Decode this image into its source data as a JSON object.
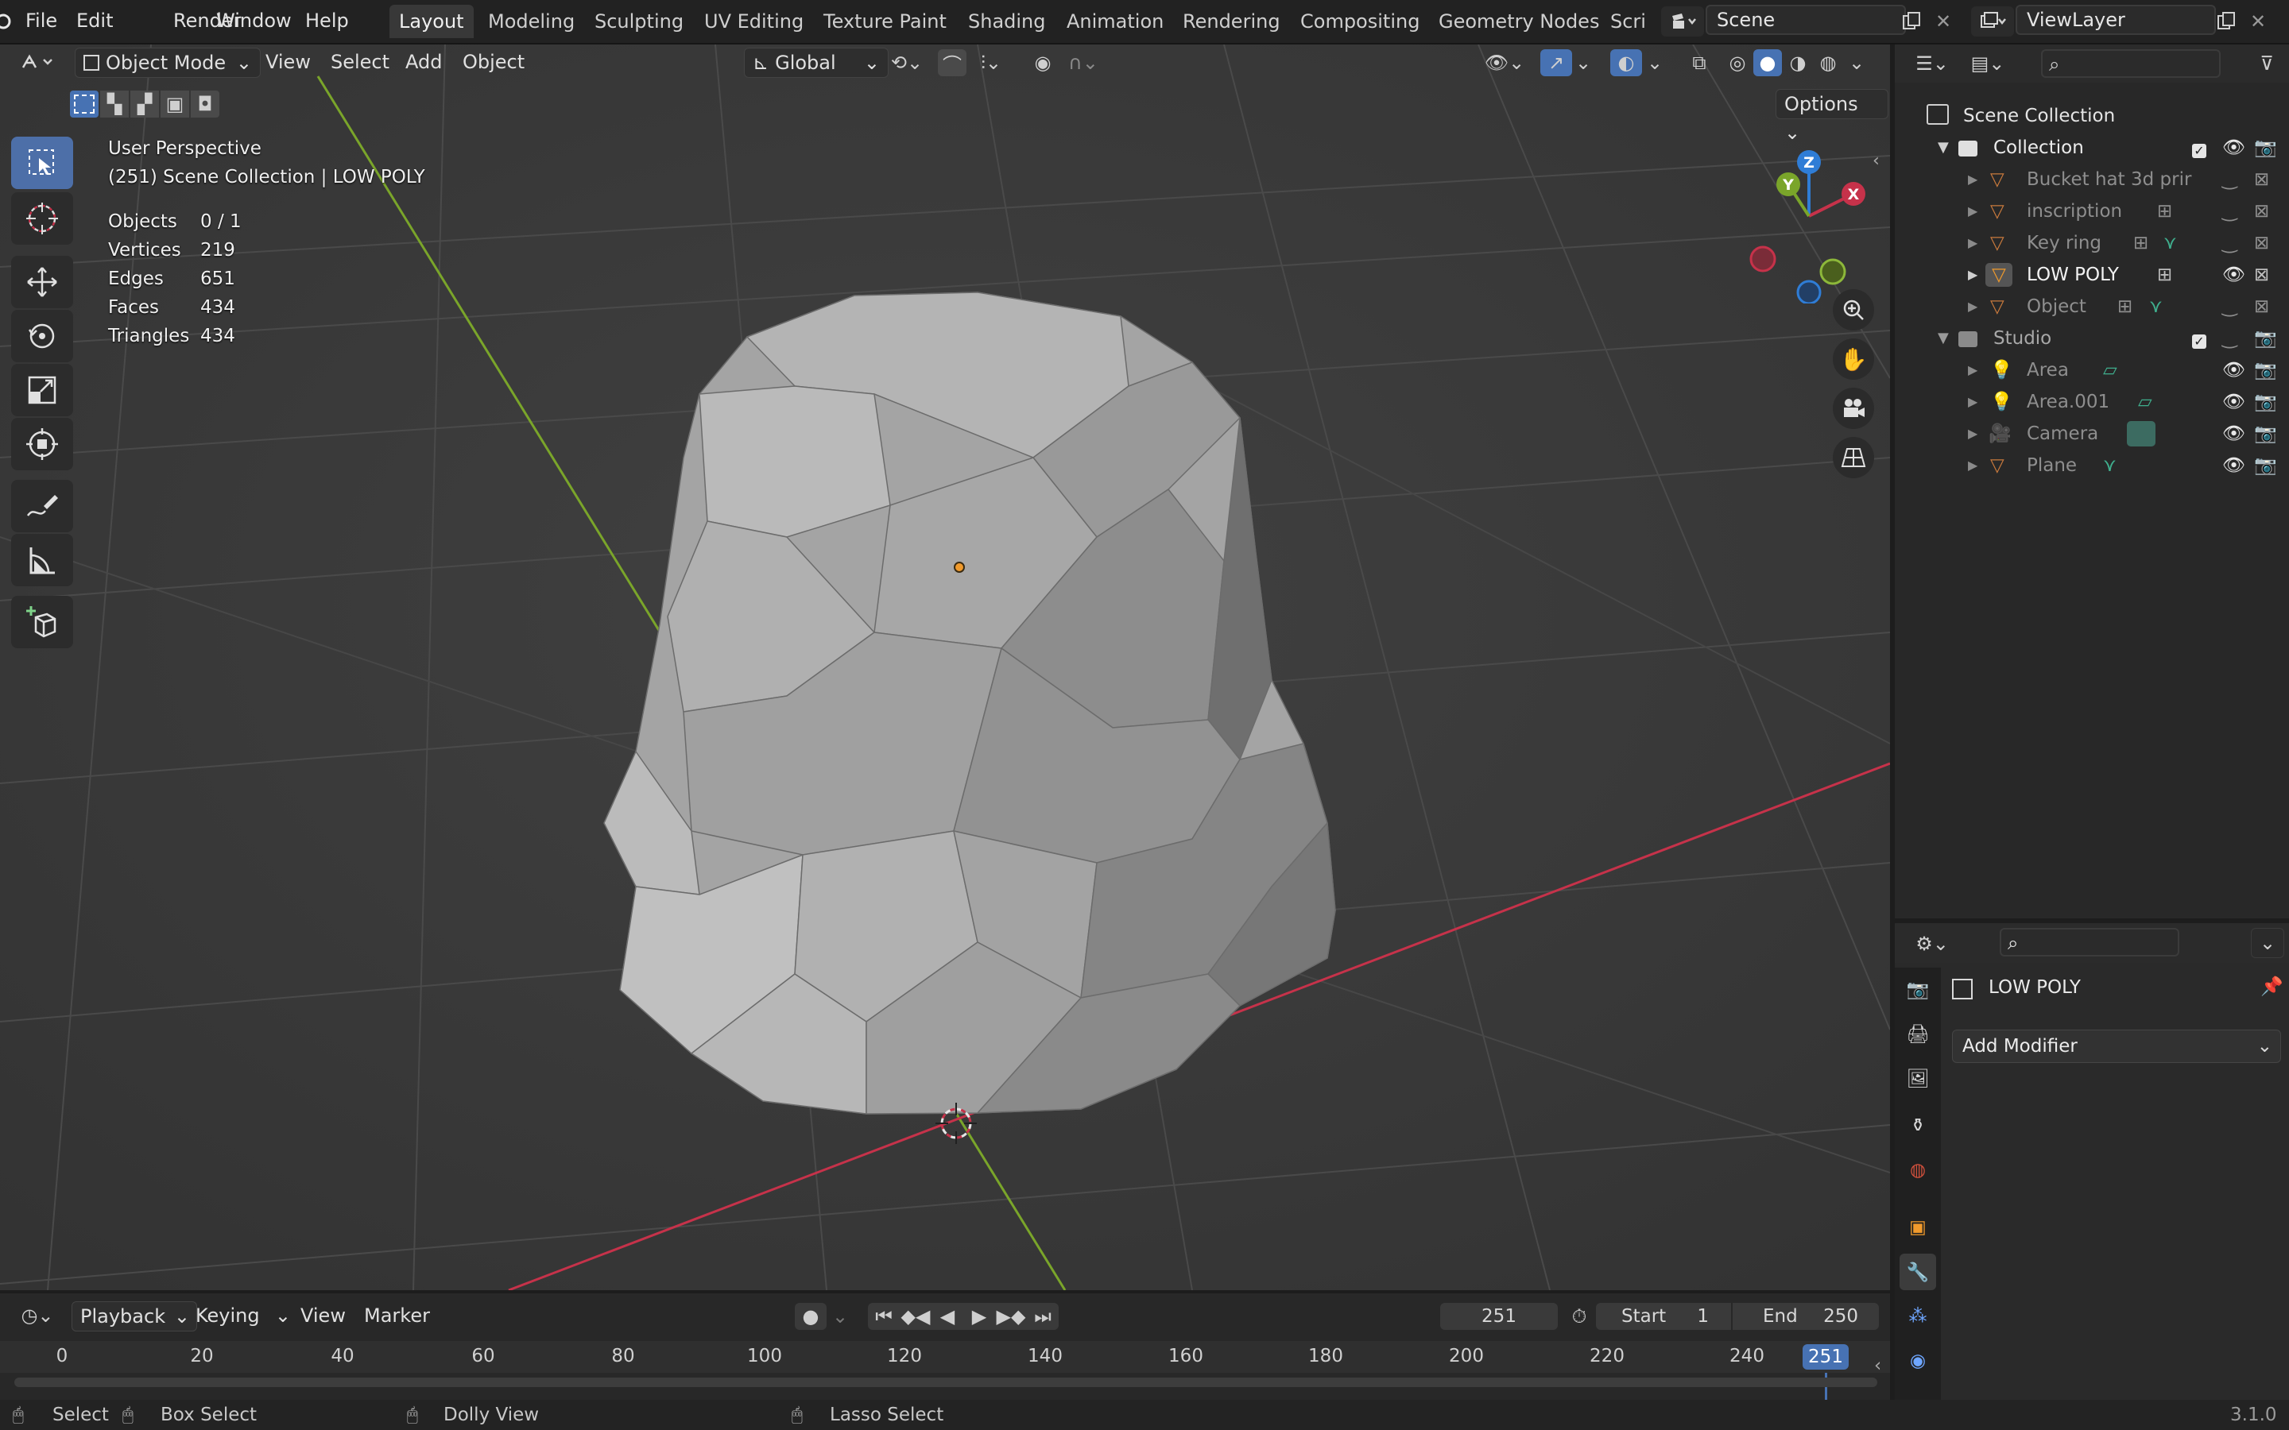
{
  "topbar": {
    "menus": [
      "File",
      "Edit",
      "Render",
      "Window",
      "Help"
    ],
    "workspaces": [
      "Layout",
      "Modeling",
      "Sculpting",
      "UV Editing",
      "Texture Paint",
      "Shading",
      "Animation",
      "Rendering",
      "Compositing",
      "Geometry Nodes",
      "Scri"
    ],
    "active_workspace": "Layout",
    "scene": "Scene",
    "view_layer": "ViewLayer"
  },
  "viewport_header": {
    "mode": "Object Mode",
    "menus": [
      "View",
      "Select",
      "Add",
      "Object"
    ],
    "orientation": "Global",
    "options_label": "Options"
  },
  "overlay": {
    "view_name": "User Perspective",
    "context": "(251) Scene Collection | LOW POLY",
    "stats": [
      {
        "label": "Objects",
        "value": "0 / 1"
      },
      {
        "label": "Vertices",
        "value": "219"
      },
      {
        "label": "Edges",
        "value": "651"
      },
      {
        "label": "Faces",
        "value": "434"
      },
      {
        "label": "Triangles",
        "value": "434"
      }
    ]
  },
  "gizmo": {
    "x": "X",
    "y": "Y",
    "z": "Z"
  },
  "outliner": {
    "root": "Scene Collection",
    "items": [
      {
        "label": "Collection",
        "type": "collection",
        "depth": 1
      },
      {
        "label": "Bucket hat 3d prir",
        "type": "mesh",
        "depth": 2,
        "dim": true
      },
      {
        "label": "inscription",
        "type": "mesh",
        "depth": 2,
        "dim": true
      },
      {
        "label": "Key ring",
        "type": "mesh",
        "depth": 2,
        "dim": true
      },
      {
        "label": "LOW POLY",
        "type": "mesh",
        "depth": 2,
        "dim": false
      },
      {
        "label": "Object",
        "type": "mesh",
        "depth": 2,
        "dim": true
      },
      {
        "label": "Studio",
        "type": "collection",
        "depth": 1,
        "dim": true
      },
      {
        "label": "Area",
        "type": "light",
        "depth": 2,
        "dim": true
      },
      {
        "label": "Area.001",
        "type": "light",
        "depth": 2,
        "dim": true
      },
      {
        "label": "Camera",
        "type": "camera",
        "depth": 2,
        "dim": true
      },
      {
        "label": "Plane",
        "type": "mesh",
        "depth": 2,
        "dim": true
      }
    ]
  },
  "properties": {
    "object_name": "LOW POLY",
    "add_modifier": "Add Modifier"
  },
  "timeline": {
    "menus": [
      "Playback",
      "Keying",
      "View",
      "Marker"
    ],
    "current_frame": "251",
    "start_label": "Start",
    "start": "1",
    "end_label": "End",
    "end": "250",
    "ticks": [
      "0",
      "20",
      "40",
      "60",
      "80",
      "100",
      "120",
      "140",
      "160",
      "180",
      "200",
      "220",
      "240"
    ],
    "playhead_label": "251"
  },
  "statusbar": {
    "select": "Select",
    "box_select": "Box Select",
    "dolly_view": "Dolly View",
    "lasso_select": "Lasso Select",
    "version": "3.1.0"
  },
  "colors": {
    "accent": "#4772b3",
    "x_axis": "#c6324a",
    "y_axis": "#7aa52a",
    "z_axis": "#2f7dd6",
    "selected_origin": "#f09a2c"
  }
}
